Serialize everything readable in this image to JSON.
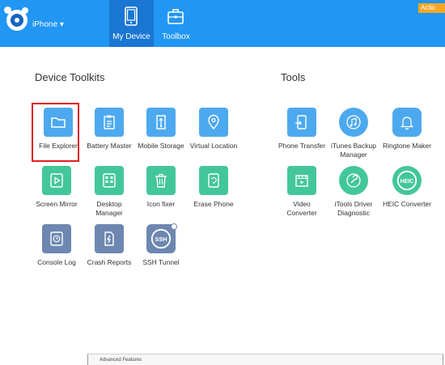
{
  "header": {
    "device_label": "iPhone ▾",
    "tabs": [
      {
        "label": "My Device",
        "icon": "phone-icon",
        "active": true
      },
      {
        "label": "Toolbox",
        "icon": "toolbox-icon",
        "active": false
      }
    ],
    "action_badge": "Actio"
  },
  "sections": {
    "device_toolkits_title": "Device Toolkits",
    "tools_title": "Tools"
  },
  "device_toolkits": [
    {
      "label": "File Explorer",
      "icon": "folder-icon"
    },
    {
      "label": "Battery Master",
      "icon": "clipboard-icon"
    },
    {
      "label": "Mobile Storage",
      "icon": "usb-icon"
    },
    {
      "label": "Virtual Location",
      "icon": "location-pin-icon"
    },
    {
      "label": "Screen Mirror",
      "icon": "play-icon"
    },
    {
      "label": "Desktop Manager",
      "icon": "grid-icon"
    },
    {
      "label": "Icon fixer",
      "icon": "trash-icon"
    },
    {
      "label": "Erase Phone",
      "icon": "erase-phone-icon"
    },
    {
      "label": "Console Log",
      "icon": "clock-icon"
    },
    {
      "label": "Crash Reports",
      "icon": "lightning-icon"
    },
    {
      "label": "SSH Tunnel",
      "icon": "ssh-icon"
    }
  ],
  "tools": [
    {
      "label": "Phone Transfer",
      "icon": "phone-transfer-icon"
    },
    {
      "label": "iTunes Backup Manager",
      "icon": "music-icon"
    },
    {
      "label": "Ringtone Maker",
      "icon": "bell-icon"
    },
    {
      "label": "Video Converter",
      "icon": "video-icon"
    },
    {
      "label": "iTools Driver Diagnostic",
      "icon": "wrench-icon"
    },
    {
      "label": "HEIC Converter",
      "icon": "heic-icon"
    }
  ],
  "tile_icon_texts": {
    "ssh": "SSH",
    "heic": "HEIC"
  },
  "bottom_window_text": "Advanced Features",
  "colors": {
    "header": "#2196f3",
    "active_tab": "#1976d2",
    "tile_blue": "#4da9ef",
    "tile_green": "#43c79a",
    "tile_slate": "#6d87b0",
    "highlight": "#e02020",
    "badge": "#f5a623"
  }
}
